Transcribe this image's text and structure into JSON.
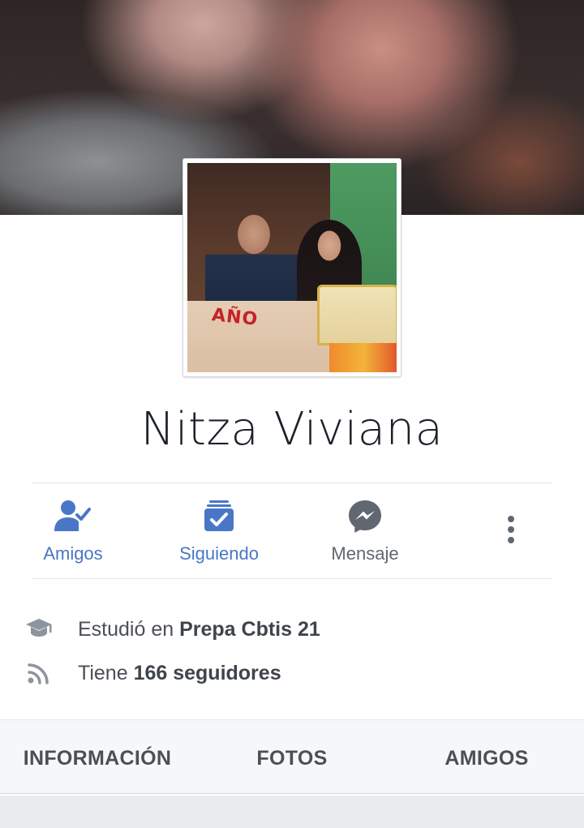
{
  "profile": {
    "name": "Nitza Viviana",
    "cover_alt": "cover-photo",
    "profile_photo_text": "AÑO"
  },
  "actions": [
    {
      "label": "Amigos",
      "icon": "friends-check-icon",
      "color": "#4a76c6"
    },
    {
      "label": "Siguiendo",
      "icon": "following-check-icon",
      "color": "#4a76c6"
    },
    {
      "label": "Mensaje",
      "icon": "messenger-icon",
      "color": "#606770"
    },
    {
      "label": "",
      "icon": "more-vertical-icon",
      "color": "#606770"
    }
  ],
  "info": {
    "education": {
      "prefix": "Estudió en ",
      "value": "Prepa Cbtis 21",
      "icon": "graduation-cap-icon"
    },
    "followers": {
      "prefix": "Tiene ",
      "value": "166 seguidores",
      "icon": "rss-feed-icon"
    }
  },
  "tabs": [
    {
      "label": "INFORMACIÓN"
    },
    {
      "label": "FOTOS"
    },
    {
      "label": "AMIGOS"
    }
  ],
  "colors": {
    "accent": "#4a76c6",
    "text_dark": "#1d2129",
    "text_grey": "#606770",
    "tab_bg": "#f6f7f9"
  }
}
